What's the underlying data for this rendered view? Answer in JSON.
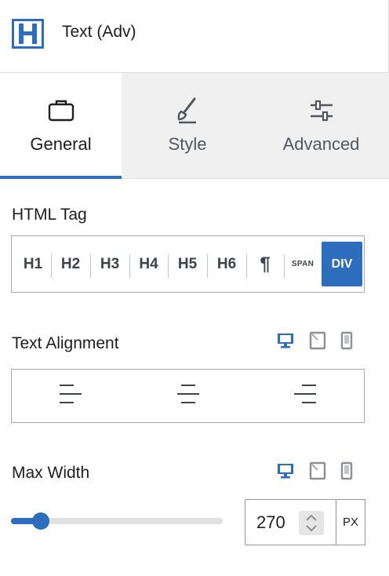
{
  "block": {
    "title": "Text (Adv)",
    "icon": "heading-h-icon"
  },
  "tabs": [
    {
      "label": "General",
      "icon": "briefcase-icon",
      "active": true
    },
    {
      "label": "Style",
      "icon": "brush-icon",
      "active": false
    },
    {
      "label": "Advanced",
      "icon": "sliders-icon",
      "active": false
    }
  ],
  "html_tag": {
    "label": "HTML Tag",
    "options": [
      "H1",
      "H2",
      "H3",
      "H4",
      "H5",
      "H6",
      "¶",
      "SPAN",
      "DIV"
    ],
    "selected": "DIV"
  },
  "text_alignment": {
    "label": "Text Alignment",
    "options": [
      "left",
      "center",
      "right"
    ],
    "devices": [
      "desktop",
      "tablet",
      "mobile"
    ],
    "active_device": "desktop"
  },
  "max_width": {
    "label": "Max Width",
    "value": "270",
    "unit": "PX",
    "slider_fraction": 0.14,
    "devices": [
      "desktop",
      "tablet",
      "mobile"
    ],
    "active_device": "desktop"
  },
  "colors": {
    "accent": "#2c6dbd",
    "device_inactive": "#8c8f94"
  }
}
